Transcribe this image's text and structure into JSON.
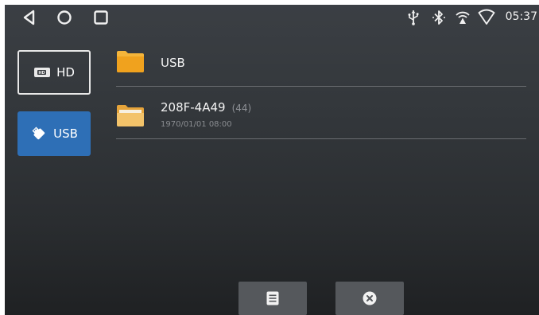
{
  "status_bar": {
    "nav_icons": [
      "back-icon",
      "home-icon",
      "recents-icon"
    ],
    "status_icons": [
      "usb-icon",
      "bluetooth-icon",
      "hotspot-icon",
      "wifi-icon"
    ],
    "time": "05:37"
  },
  "sidebar": {
    "items": [
      {
        "label": "HD",
        "icon": "hard-drive-icon",
        "selected": false
      },
      {
        "label": "USB",
        "icon": "usb-drive-icon",
        "selected": true
      }
    ]
  },
  "file_list": {
    "items": [
      {
        "name": "USB",
        "count": "",
        "date": "",
        "icon": "folder-icon"
      },
      {
        "name": "208F-4A49",
        "count": "(44)",
        "date": "1970/01/01 08:00",
        "icon": "folder-open-icon"
      }
    ]
  },
  "bottom_bar": {
    "buttons": [
      {
        "icon": "list-icon"
      },
      {
        "icon": "close-circle-icon"
      }
    ]
  },
  "colors": {
    "accent": "#2e6fb6",
    "folder": "#f2a623",
    "background_top": "#3b3f44",
    "background_bottom": "#1f2123"
  }
}
